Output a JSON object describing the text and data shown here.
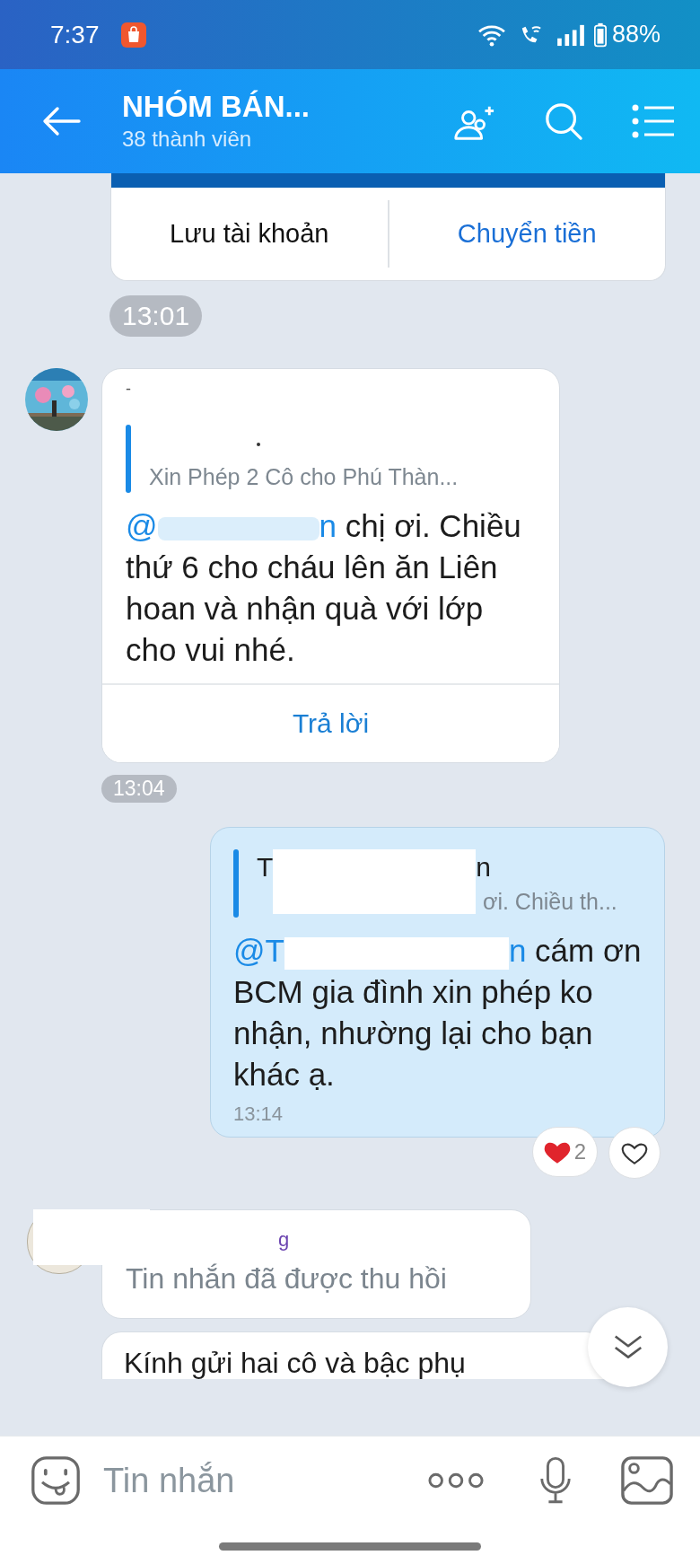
{
  "status_bar": {
    "time": "7:37",
    "battery": "88%"
  },
  "header": {
    "title": "NHÓM BÁN...",
    "subtitle": "38 thành viên"
  },
  "bank_card": {
    "buttons": [
      {
        "label": "Lưu tài khoản",
        "kind": "plain"
      },
      {
        "label": "Chuyển tiền",
        "kind": "primary"
      }
    ]
  },
  "messages": [
    {
      "kind": "time",
      "time": "13:01"
    },
    {
      "kind": "incoming",
      "sender": "-",
      "quote": {
        "text": "Xin Phép 2 Cô cho Phú Thàn..."
      },
      "mention_start": "@",
      "mention_end": "n",
      "text": " chị ơi. Chiều thứ 6 cho cháu lên ăn Liên hoan và nhận quà với lớp cho vui nhé.",
      "reply": "Trả lời"
    },
    {
      "kind": "time_small",
      "time": "13:04"
    },
    {
      "kind": "outgoing",
      "quote": {
        "name_start": "T",
        "name_end": "n",
        "text": "ơi. Chiều th..."
      },
      "mention_start": "@T",
      "mention_end": "n",
      "text": " cám ơn BCM gia đình xin phép ko nhận, nhường lại cho bạn khác ạ.",
      "time": "13:14",
      "reaction_count": "2"
    },
    {
      "kind": "recalled",
      "sender": "g",
      "text": "Tin nhắn đã được thu hồi"
    },
    {
      "kind": "partial",
      "text": "Kính gửi hai cô và bậc phụ"
    }
  ],
  "composer": {
    "placeholder": "Tin nhắn"
  }
}
